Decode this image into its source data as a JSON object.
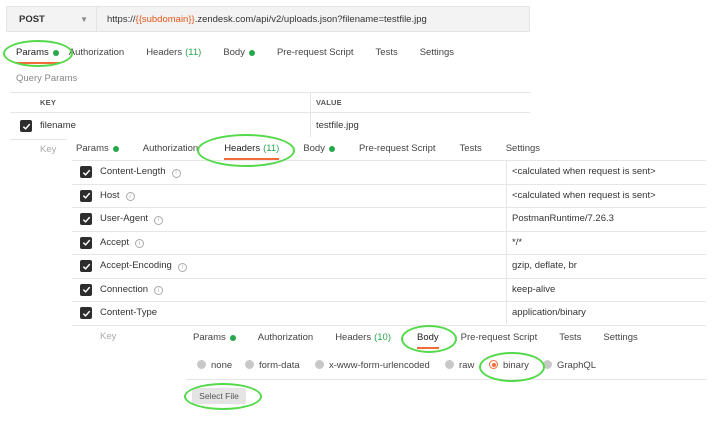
{
  "request": {
    "method": "POST",
    "url_prefix": "https://",
    "url_variable": "{{subdomain}}",
    "url_suffix": ".zendesk.com/api/v2/uploads.json?filename=testfile.jpg"
  },
  "tabs_params_view": [
    {
      "label": "Params",
      "dot": true
    },
    {
      "label": "Authorization"
    },
    {
      "label": "Headers",
      "count": "(11)"
    },
    {
      "label": "Body",
      "dot": true
    },
    {
      "label": "Pre-request Script"
    },
    {
      "label": "Tests"
    },
    {
      "label": "Settings"
    }
  ],
  "query_params": {
    "section_label": "Query Params",
    "col_key": "KEY",
    "col_value": "VALUE",
    "rows": [
      {
        "key": "filename",
        "value": "testfile.jpg"
      }
    ],
    "key_placeholder": "Key"
  },
  "tabs_headers_view": [
    {
      "label": "Params",
      "dot": true
    },
    {
      "label": "Authorization"
    },
    {
      "label": "Headers",
      "count": "(11)"
    },
    {
      "label": "Body",
      "dot": true
    },
    {
      "label": "Pre-request Script"
    },
    {
      "label": "Tests"
    },
    {
      "label": "Settings"
    }
  ],
  "headers": {
    "rows": [
      {
        "key": "Content-Length",
        "value": "<calculated when request is sent>"
      },
      {
        "key": "Host",
        "value": "<calculated when request is sent>"
      },
      {
        "key": "User-Agent",
        "value": "PostmanRuntime/7.26.3"
      },
      {
        "key": "Accept",
        "value": "*/*"
      },
      {
        "key": "Accept-Encoding",
        "value": "gzip, deflate, br"
      },
      {
        "key": "Connection",
        "value": "keep-alive"
      },
      {
        "key": "Content-Type",
        "value": "application/binary"
      }
    ],
    "key_placeholder": "Key"
  },
  "tabs_body_view": [
    {
      "label": "Params",
      "dot": true
    },
    {
      "label": "Authorization"
    },
    {
      "label": "Headers",
      "count": "(10)"
    },
    {
      "label": "Body"
    },
    {
      "label": "Pre-request Script"
    },
    {
      "label": "Tests"
    },
    {
      "label": "Settings"
    }
  ],
  "body_options": [
    "none",
    "form-data",
    "x-www-form-urlencoded",
    "raw",
    "binary",
    "GraphQL"
  ],
  "body_selected": "binary",
  "select_file_label": "Select File",
  "info_glyph": "i",
  "colors": {
    "accent": "#f26b3a",
    "active_dot": "#27a84b",
    "highlight_ring": "#53d94a"
  }
}
